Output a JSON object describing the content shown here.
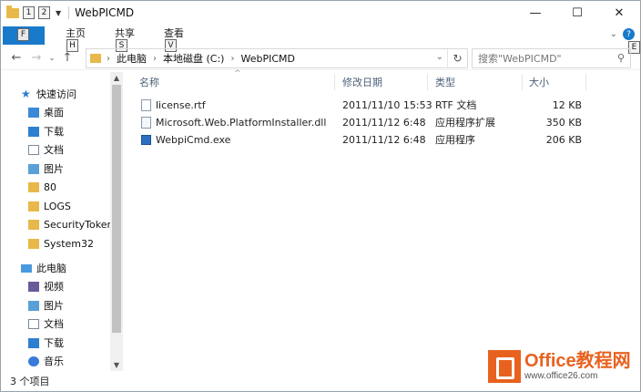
{
  "window": {
    "title": "WebPICMD",
    "keytip_1": "1",
    "keytip_2": "2",
    "btn_min": "—",
    "btn_max": "☐",
    "btn_close": "✕"
  },
  "ribbon": {
    "file_keytip": "F",
    "tabs": [
      {
        "label": "主页",
        "keytip": "H"
      },
      {
        "label": "共享",
        "keytip": "S"
      },
      {
        "label": "查看",
        "keytip": "V"
      }
    ],
    "help_keytip": "E"
  },
  "nav": {
    "breadcrumb": [
      "此电脑",
      "本地磁盘 (C:)",
      "WebPICMD"
    ],
    "search_placeholder": "搜索\"WebPICMD\""
  },
  "sidebar": {
    "quick_access": "快速访问",
    "items": [
      {
        "label": "桌面",
        "icon": "desktop-icon",
        "pinned": true
      },
      {
        "label": "下载",
        "icon": "download-icon",
        "pinned": true
      },
      {
        "label": "文档",
        "icon": "document-icon",
        "pinned": true
      },
      {
        "label": "图片",
        "icon": "picture-icon",
        "pinned": true
      },
      {
        "label": "80",
        "icon": "folder-icon",
        "pinned": false
      },
      {
        "label": "LOGS",
        "icon": "folder-icon",
        "pinned": false
      },
      {
        "label": "SecurityToken",
        "icon": "folder-icon",
        "pinned": false
      },
      {
        "label": "System32",
        "icon": "folder-icon",
        "pinned": false
      }
    ],
    "this_pc": "此电脑",
    "pc_items": [
      {
        "label": "视频",
        "icon": "video-icon"
      },
      {
        "label": "图片",
        "icon": "picture-icon"
      },
      {
        "label": "文档",
        "icon": "document-icon"
      },
      {
        "label": "下载",
        "icon": "download-icon"
      },
      {
        "label": "音乐",
        "icon": "music-icon"
      }
    ]
  },
  "table": {
    "headers": {
      "name": "名称",
      "date": "修改日期",
      "type": "类型",
      "size": "大小"
    },
    "rows": [
      {
        "name": "license.rtf",
        "date": "2011/11/10 15:53",
        "type": "RTF 文档",
        "size": "12 KB",
        "icon": "rtf-file-icon"
      },
      {
        "name": "Microsoft.Web.PlatformInstaller.dll",
        "date": "2011/11/12 6:48",
        "type": "应用程序扩展",
        "size": "350 KB",
        "icon": "dll-file-icon"
      },
      {
        "name": "WebpiCmd.exe",
        "date": "2011/11/12 6:48",
        "type": "应用程序",
        "size": "206 KB",
        "icon": "exe-file-icon"
      }
    ]
  },
  "status": {
    "count": "3 个项目"
  },
  "watermark": {
    "brand": "Office教程网",
    "url": "www.office26.com"
  }
}
